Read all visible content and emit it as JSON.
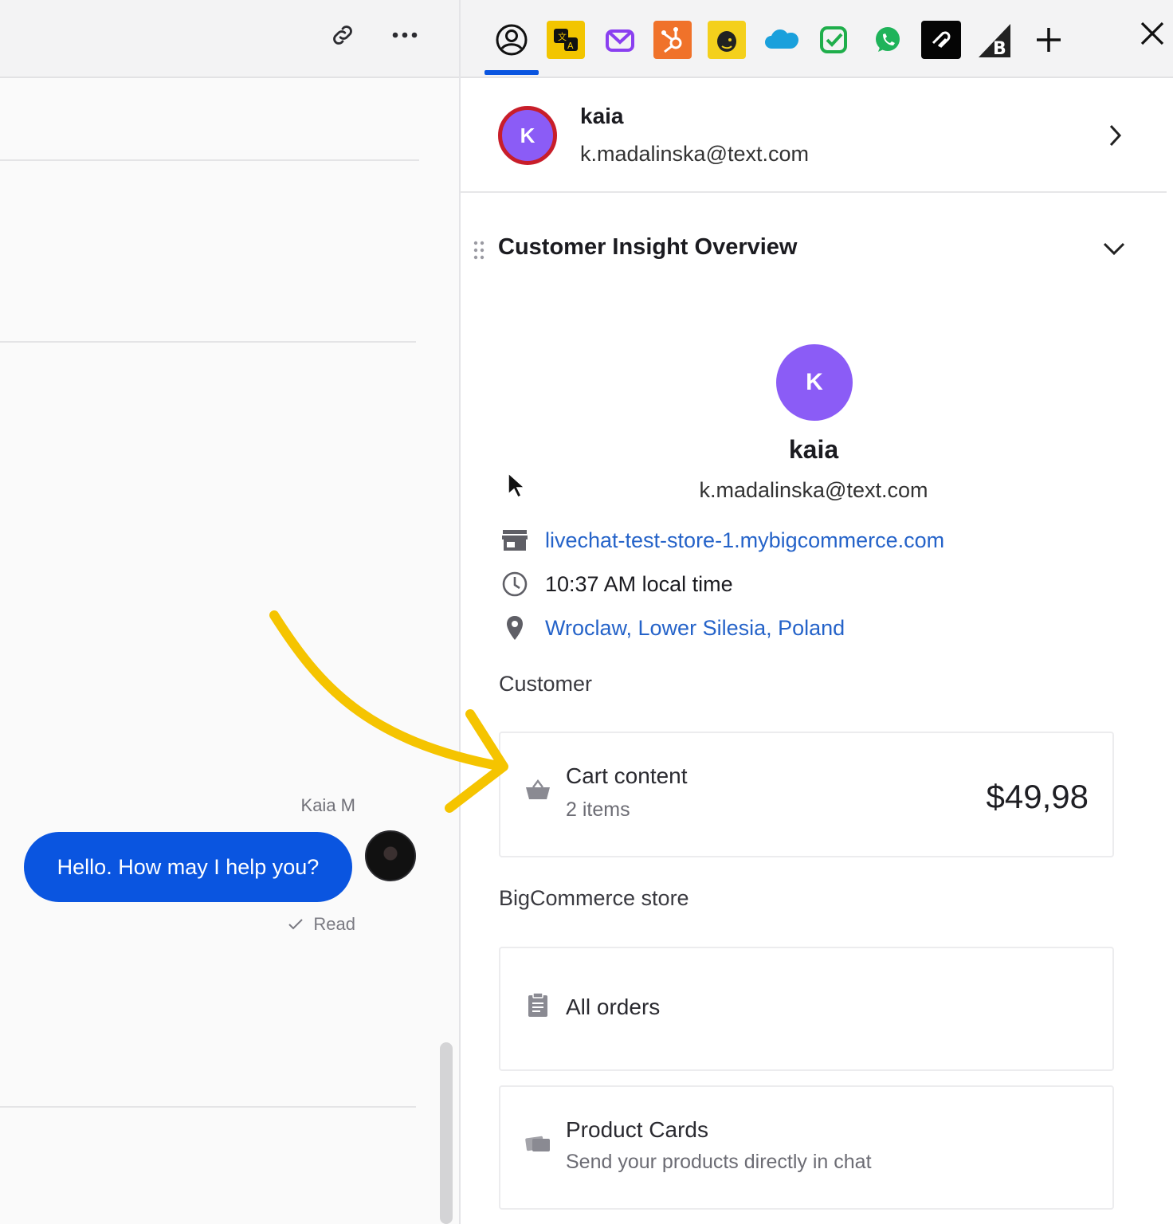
{
  "chat": {
    "sender_name": "Kaia M",
    "message": "Hello. How may I help you?",
    "read_status": "Read",
    "icons": [
      "link-icon",
      "more-icon",
      "check-icon"
    ]
  },
  "toolbar": {
    "active_tab": "customer-details",
    "apps": [
      "customer-details",
      "translate",
      "mail",
      "hubspot",
      "mailchimp",
      "salesforce",
      "tasks",
      "whatsapp",
      "squarespace",
      "bigcommerce",
      "add"
    ],
    "close_icon": "close-icon"
  },
  "customer_header": {
    "avatar_initial": "K",
    "name": "kaia",
    "email": "k.madalinska@text.com"
  },
  "overview": {
    "title": "Customer Insight Overview",
    "avatar_initial": "K",
    "name": "kaia",
    "email": "k.madalinska@text.com",
    "store": "livechat-test-store-1.mybigcommerce.com",
    "local_time": "10:37 AM local time",
    "location": "Wroclaw, Lower Silesia, Poland"
  },
  "customer_section": {
    "label": "Customer",
    "cart": {
      "title": "Cart content",
      "items": "2 items",
      "total": "$49,98"
    }
  },
  "store_section": {
    "label": "BigCommerce store",
    "all_orders": "All orders",
    "product_cards": {
      "title": "Product Cards",
      "subtitle": "Send your products directly in chat"
    }
  },
  "colors": {
    "accent": "#0a55e0",
    "avatar": "#8b5cf6",
    "link": "#2563c9",
    "annotation_arrow": "#f5c400"
  }
}
